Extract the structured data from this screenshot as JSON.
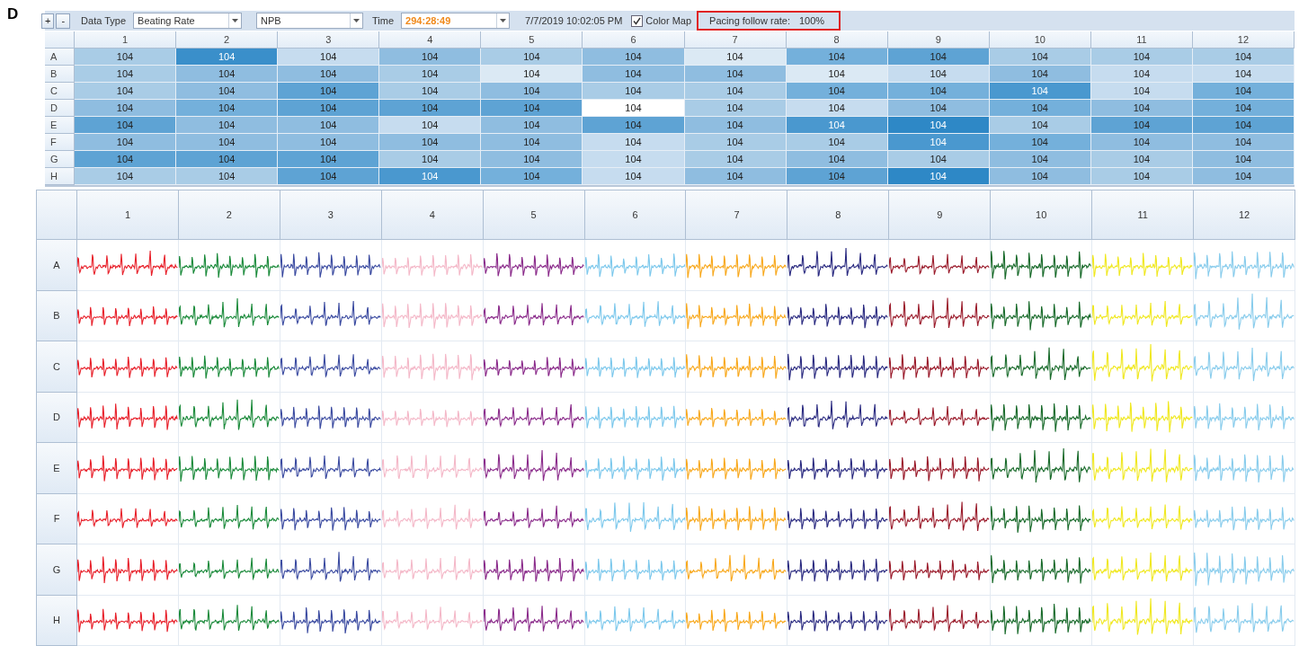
{
  "figure_label": "D",
  "toolbar": {
    "buttons": [
      "+",
      "-"
    ],
    "data_type_label": "Data Type",
    "data_type": {
      "value": "Beating Rate"
    },
    "series": {
      "value": "NPB"
    },
    "time_label": "Time",
    "time": {
      "value": "294:28:49"
    },
    "timestamp": "7/7/2019 10:02:05 PM",
    "color_map": {
      "label": "Color Map",
      "checked": true
    },
    "pacing": {
      "label": "Pacing follow rate:",
      "value": "100%",
      "highlighted": true
    }
  },
  "heat_table": {
    "columns": [
      "1",
      "2",
      "3",
      "4",
      "5",
      "6",
      "7",
      "8",
      "9",
      "10",
      "11",
      "12"
    ],
    "rows": [
      {
        "label": "A",
        "cells": [
          {
            "text": "104",
            "color": "#a9cce6"
          },
          {
            "text": "104",
            "color": "#3a8fca"
          },
          {
            "text": "104",
            "color": "#c6dcef"
          },
          {
            "text": "104",
            "color": "#8fbde0"
          },
          {
            "text": "104",
            "color": "#a9cce6"
          },
          {
            "text": "104",
            "color": "#8fbde0"
          },
          {
            "text": "104",
            "color": "#dbe9f4"
          },
          {
            "text": "104",
            "color": "#74b0db"
          },
          {
            "text": "104",
            "color": "#5ea3d4"
          },
          {
            "text": "104",
            "color": "#a9cce6"
          },
          {
            "text": "104",
            "color": "#a9cce6"
          },
          {
            "text": "104",
            "color": "#a9cce6"
          }
        ]
      },
      {
        "label": "B",
        "cells": [
          {
            "text": "104",
            "color": "#a9cce6"
          },
          {
            "text": "104",
            "color": "#8fbde0"
          },
          {
            "text": "104",
            "color": "#8fbde0"
          },
          {
            "text": "104",
            "color": "#a9cce6"
          },
          {
            "text": "104",
            "color": "#dbe9f4"
          },
          {
            "text": "104",
            "color": "#8fbde0"
          },
          {
            "text": "104",
            "color": "#8fbde0"
          },
          {
            "text": "104",
            "color": "#dbe9f4"
          },
          {
            "text": "104",
            "color": "#c6dcef"
          },
          {
            "text": "104",
            "color": "#8fbde0"
          },
          {
            "text": "104",
            "color": "#c6dcef"
          },
          {
            "text": "104",
            "color": "#c6dcef"
          }
        ]
      },
      {
        "label": "C",
        "cells": [
          {
            "text": "104",
            "color": "#a9cce6"
          },
          {
            "text": "104",
            "color": "#8fbde0"
          },
          {
            "text": "104",
            "color": "#5ea3d4"
          },
          {
            "text": "104",
            "color": "#a9cce6"
          },
          {
            "text": "104",
            "color": "#8fbde0"
          },
          {
            "text": "104",
            "color": "#a9cce6"
          },
          {
            "text": "104",
            "color": "#a9cce6"
          },
          {
            "text": "104",
            "color": "#74b0db"
          },
          {
            "text": "104",
            "color": "#74b0db"
          },
          {
            "text": "104",
            "color": "#4a98cf"
          },
          {
            "text": "104",
            "color": "#c6dcef"
          },
          {
            "text": "104",
            "color": "#74b0db"
          }
        ]
      },
      {
        "label": "D",
        "cells": [
          {
            "text": "104",
            "color": "#8fbde0"
          },
          {
            "text": "104",
            "color": "#74b0db"
          },
          {
            "text": "104",
            "color": "#5ea3d4"
          },
          {
            "text": "104",
            "color": "#5ea3d4"
          },
          {
            "text": "104",
            "color": "#5ea3d4"
          },
          {
            "text": "104",
            "color": "#ffffff"
          },
          {
            "text": "104",
            "color": "#a9cce6"
          },
          {
            "text": "104",
            "color": "#c6dcef"
          },
          {
            "text": "104",
            "color": "#8fbde0"
          },
          {
            "text": "104",
            "color": "#74b0db"
          },
          {
            "text": "104",
            "color": "#8fbde0"
          },
          {
            "text": "104",
            "color": "#74b0db"
          }
        ]
      },
      {
        "label": "E",
        "cells": [
          {
            "text": "104",
            "color": "#5ea3d4"
          },
          {
            "text": "104",
            "color": "#8fbde0"
          },
          {
            "text": "104",
            "color": "#8fbde0"
          },
          {
            "text": "104",
            "color": "#c6dcef"
          },
          {
            "text": "104",
            "color": "#8fbde0"
          },
          {
            "text": "104",
            "color": "#5ea3d4"
          },
          {
            "text": "104",
            "color": "#8fbde0"
          },
          {
            "text": "104",
            "color": "#4a98cf"
          },
          {
            "text": "104",
            "color": "#2e88c6"
          },
          {
            "text": "104",
            "color": "#a9cce6"
          },
          {
            "text": "104",
            "color": "#5ea3d4"
          },
          {
            "text": "104",
            "color": "#5ea3d4"
          }
        ]
      },
      {
        "label": "F",
        "cells": [
          {
            "text": "104",
            "color": "#8fbde0"
          },
          {
            "text": "104",
            "color": "#8fbde0"
          },
          {
            "text": "104",
            "color": "#8fbde0"
          },
          {
            "text": "104",
            "color": "#8fbde0"
          },
          {
            "text": "104",
            "color": "#8fbde0"
          },
          {
            "text": "104",
            "color": "#c6dcef"
          },
          {
            "text": "104",
            "color": "#a9cce6"
          },
          {
            "text": "104",
            "color": "#a9cce6"
          },
          {
            "text": "104",
            "color": "#4a98cf"
          },
          {
            "text": "104",
            "color": "#74b0db"
          },
          {
            "text": "104",
            "color": "#8fbde0"
          },
          {
            "text": "104",
            "color": "#8fbde0"
          }
        ]
      },
      {
        "label": "G",
        "cells": [
          {
            "text": "104",
            "color": "#5ea3d4"
          },
          {
            "text": "104",
            "color": "#5ea3d4"
          },
          {
            "text": "104",
            "color": "#5ea3d4"
          },
          {
            "text": "104",
            "color": "#a9cce6"
          },
          {
            "text": "104",
            "color": "#8fbde0"
          },
          {
            "text": "104",
            "color": "#c6dcef"
          },
          {
            "text": "104",
            "color": "#a9cce6"
          },
          {
            "text": "104",
            "color": "#8fbde0"
          },
          {
            "text": "104",
            "color": "#a9cce6"
          },
          {
            "text": "104",
            "color": "#8fbde0"
          },
          {
            "text": "104",
            "color": "#a9cce6"
          },
          {
            "text": "104",
            "color": "#8fbde0"
          }
        ]
      },
      {
        "label": "H",
        "cells": [
          {
            "text": "104",
            "color": "#a9cce6"
          },
          {
            "text": "104",
            "color": "#a9cce6"
          },
          {
            "text": "104",
            "color": "#5ea3d4"
          },
          {
            "text": "104",
            "color": "#4a98cf"
          },
          {
            "text": "104",
            "color": "#74b0db"
          },
          {
            "text": "104",
            "color": "#c6dcef"
          },
          {
            "text": "104",
            "color": "#8fbde0"
          },
          {
            "text": "104",
            "color": "#5ea3d4"
          },
          {
            "text": "104",
            "color": "#2e88c6"
          },
          {
            "text": "104",
            "color": "#8fbde0"
          },
          {
            "text": "104",
            "color": "#a9cce6"
          },
          {
            "text": "104",
            "color": "#8fbde0"
          }
        ]
      }
    ]
  },
  "trace_grid": {
    "columns": [
      {
        "label": "1",
        "color": "#e8202a"
      },
      {
        "label": "2",
        "color": "#1a8a3a"
      },
      {
        "label": "3",
        "color": "#3a4aa0"
      },
      {
        "label": "4",
        "color": "#f4b8c8"
      },
      {
        "label": "5",
        "color": "#8a2a8a"
      },
      {
        "label": "6",
        "color": "#7cc8ec"
      },
      {
        "label": "7",
        "color": "#f8a81c"
      },
      {
        "label": "8",
        "color": "#2a2a80"
      },
      {
        "label": "9",
        "color": "#9a1a2a"
      },
      {
        "label": "10",
        "color": "#186a2a"
      },
      {
        "label": "11",
        "color": "#f0e820"
      },
      {
        "label": "12",
        "color": "#88ccec"
      }
    ],
    "rows": [
      "A",
      "B",
      "C",
      "D",
      "E",
      "F",
      "G",
      "H"
    ]
  }
}
